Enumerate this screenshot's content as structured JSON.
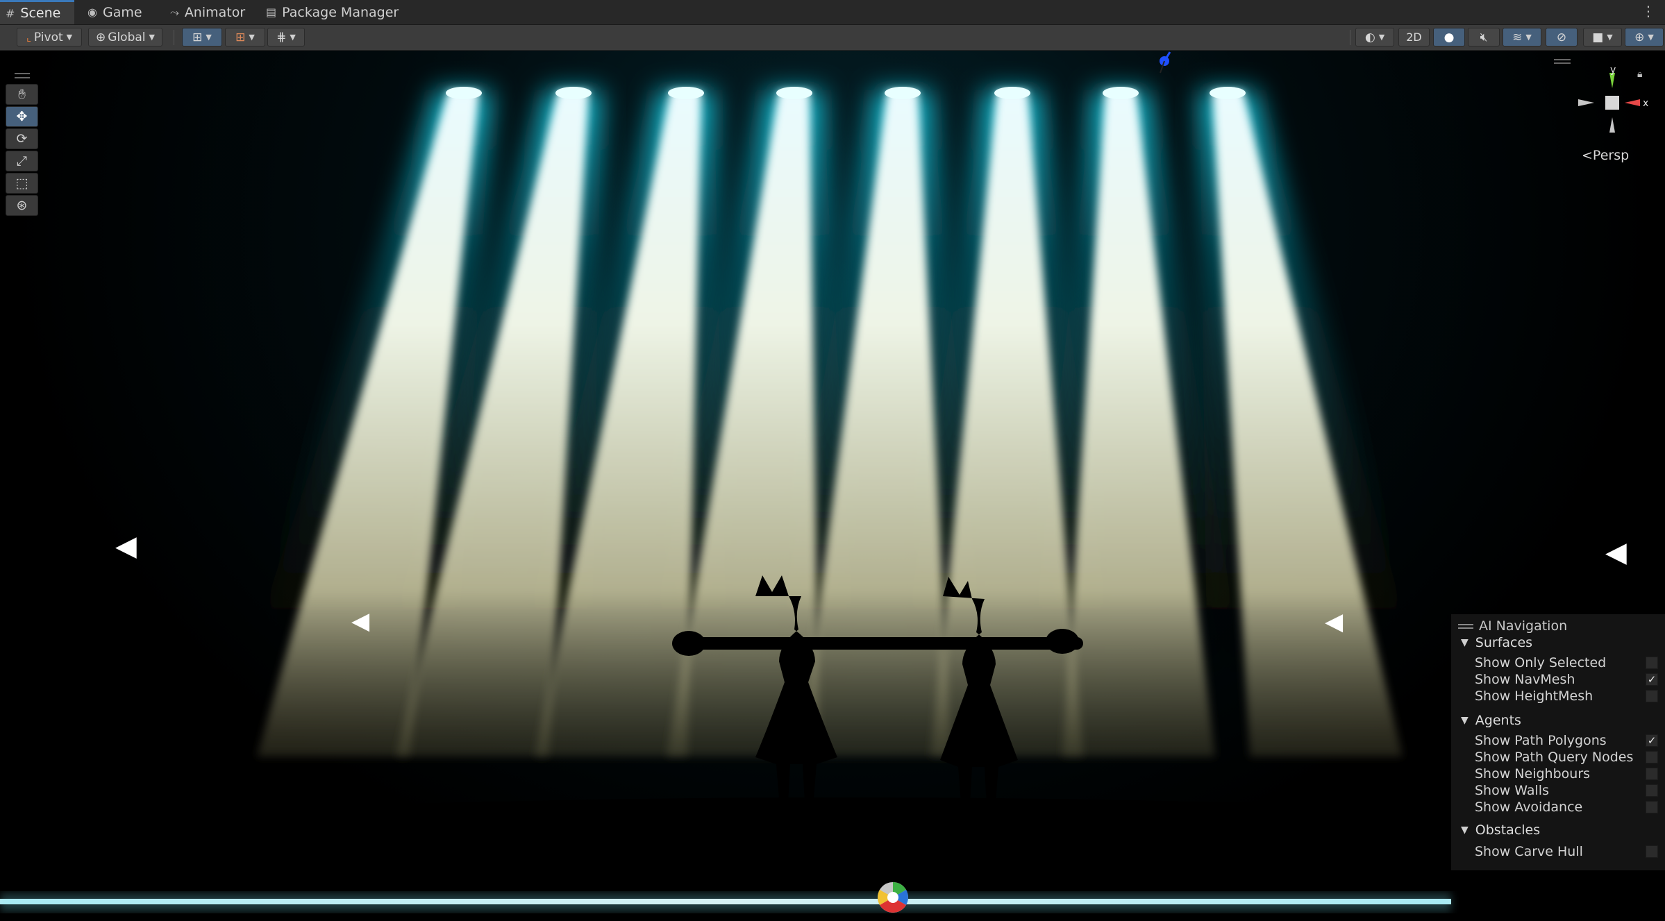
{
  "tabs": [
    {
      "label": "Scene",
      "icon": "grid-icon"
    },
    {
      "label": "Game",
      "icon": "gamepad-icon"
    },
    {
      "label": "Animator",
      "icon": "animator-icon"
    },
    {
      "label": "Package Manager",
      "icon": "package-icon"
    }
  ],
  "toolbar": {
    "pivot": "Pivot",
    "global": "Global",
    "twod": "2D"
  },
  "gizmo": {
    "x_label": "x",
    "y_label": "y",
    "projection": "Persp"
  },
  "ai_navigation": {
    "title": "AI Navigation",
    "surfaces": {
      "label": "Surfaces",
      "items": [
        {
          "label": "Show Only Selected",
          "checked": false
        },
        {
          "label": "Show NavMesh",
          "checked": true
        },
        {
          "label": "Show HeightMesh",
          "checked": false
        }
      ]
    },
    "agents": {
      "label": "Agents",
      "items": [
        {
          "label": "Show Path Polygons",
          "checked": true
        },
        {
          "label": "Show Path Query Nodes",
          "checked": false
        },
        {
          "label": "Show Neighbours",
          "checked": false
        },
        {
          "label": "Show Walls",
          "checked": false
        },
        {
          "label": "Show Avoidance",
          "checked": false
        }
      ]
    },
    "obstacles": {
      "label": "Obstacles",
      "items": [
        {
          "label": "Show Carve Hull",
          "checked": false
        }
      ]
    }
  },
  "colors": {
    "beam_glow": "#17d7ef",
    "beam_core": "#f4f3dc",
    "accent": "#3a79bb",
    "toolbar_bg": "#3c3c3c"
  }
}
